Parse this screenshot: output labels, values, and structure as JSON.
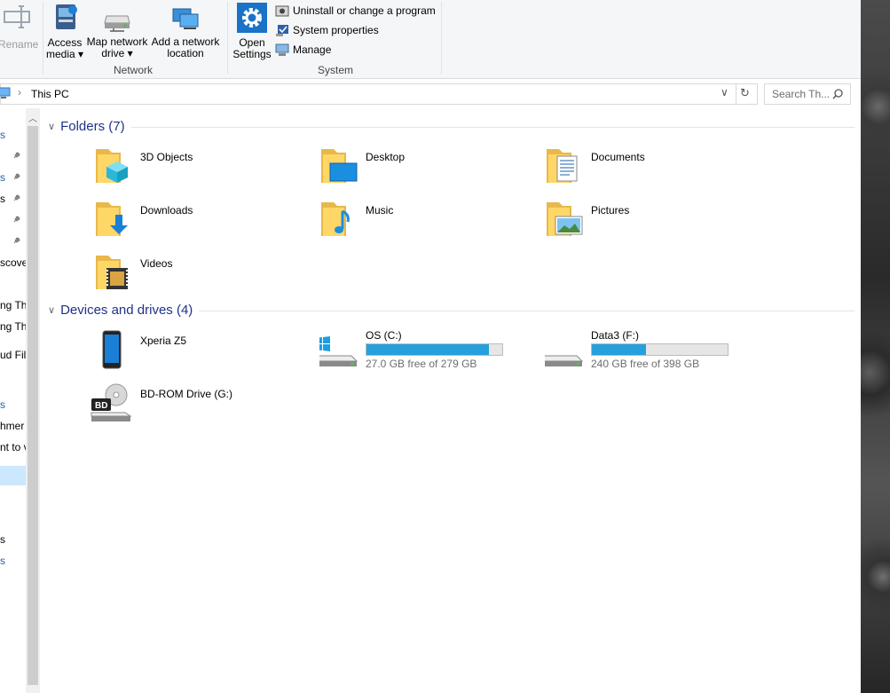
{
  "ribbon": {
    "rename_label": "Rename",
    "access_media_label_1": "Access",
    "access_media_label_2": "media ▾",
    "map_drive_label_1": "Map network",
    "map_drive_label_2": "drive ▾",
    "add_location_label_1": "Add a network",
    "add_location_label_2": "location",
    "network_group": "Network",
    "open_settings_label_1": "Open",
    "open_settings_label_2": "Settings",
    "uninstall_label": "Uninstall or change a program",
    "system_properties_label": "System properties",
    "manage_label": "Manage",
    "system_group": "System"
  },
  "address": {
    "path": "This PC"
  },
  "search": {
    "placeholder": "Search Th..."
  },
  "nav": {
    "items": [
      "s",
      "s",
      "s",
      "s",
      "scove",
      "ng Th",
      "ng Th",
      "ud Fil",
      "s",
      "hmer",
      "nt to v",
      "s",
      "s"
    ]
  },
  "folders": {
    "header": "Folders (7)",
    "items": [
      {
        "name": "3D Objects",
        "icon": "3d-objects-folder-icon"
      },
      {
        "name": "Desktop",
        "icon": "desktop-folder-icon"
      },
      {
        "name": "Documents",
        "icon": "documents-folder-icon"
      },
      {
        "name": "Downloads",
        "icon": "downloads-folder-icon"
      },
      {
        "name": "Music",
        "icon": "music-folder-icon"
      },
      {
        "name": "Pictures",
        "icon": "pictures-folder-icon"
      },
      {
        "name": "Videos",
        "icon": "videos-folder-icon"
      }
    ]
  },
  "devices": {
    "header": "Devices and drives (4)",
    "items": [
      {
        "name": "Xperia Z5",
        "icon": "phone-icon"
      },
      {
        "name": "OS (C:)",
        "free_text": "27.0 GB free of 279 GB",
        "used_fraction": 0.903,
        "icon": "windows-drive-icon"
      },
      {
        "name": "Data3 (F:)",
        "free_text": "240 GB free of 398 GB",
        "used_fraction": 0.397,
        "icon": "hard-drive-icon"
      },
      {
        "name": "BD-ROM Drive (G:)",
        "icon": "bd-rom-drive-icon"
      }
    ]
  },
  "colors": {
    "section_header": "#1e3287",
    "drive_bar": "#26a0da",
    "folder": "#ffd767"
  }
}
